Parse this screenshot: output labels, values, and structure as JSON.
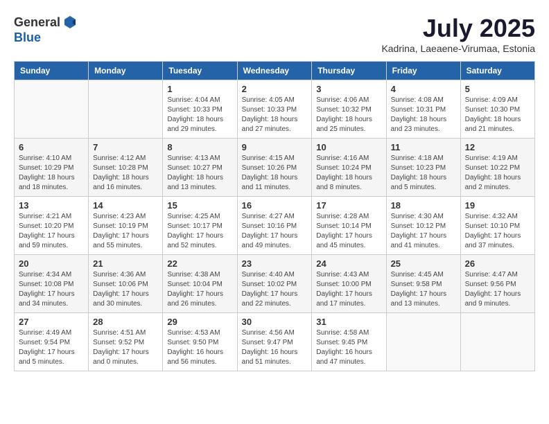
{
  "header": {
    "logo_general": "General",
    "logo_blue": "Blue",
    "month_title": "July 2025",
    "location": "Kadrina, Laeaene-Virumaa, Estonia"
  },
  "days_of_week": [
    "Sunday",
    "Monday",
    "Tuesday",
    "Wednesday",
    "Thursday",
    "Friday",
    "Saturday"
  ],
  "weeks": [
    [
      {
        "day": "",
        "info": ""
      },
      {
        "day": "",
        "info": ""
      },
      {
        "day": "1",
        "info": "Sunrise: 4:04 AM\nSunset: 10:33 PM\nDaylight: 18 hours\nand 29 minutes."
      },
      {
        "day": "2",
        "info": "Sunrise: 4:05 AM\nSunset: 10:33 PM\nDaylight: 18 hours\nand 27 minutes."
      },
      {
        "day": "3",
        "info": "Sunrise: 4:06 AM\nSunset: 10:32 PM\nDaylight: 18 hours\nand 25 minutes."
      },
      {
        "day": "4",
        "info": "Sunrise: 4:08 AM\nSunset: 10:31 PM\nDaylight: 18 hours\nand 23 minutes."
      },
      {
        "day": "5",
        "info": "Sunrise: 4:09 AM\nSunset: 10:30 PM\nDaylight: 18 hours\nand 21 minutes."
      }
    ],
    [
      {
        "day": "6",
        "info": "Sunrise: 4:10 AM\nSunset: 10:29 PM\nDaylight: 18 hours\nand 18 minutes."
      },
      {
        "day": "7",
        "info": "Sunrise: 4:12 AM\nSunset: 10:28 PM\nDaylight: 18 hours\nand 16 minutes."
      },
      {
        "day": "8",
        "info": "Sunrise: 4:13 AM\nSunset: 10:27 PM\nDaylight: 18 hours\nand 13 minutes."
      },
      {
        "day": "9",
        "info": "Sunrise: 4:15 AM\nSunset: 10:26 PM\nDaylight: 18 hours\nand 11 minutes."
      },
      {
        "day": "10",
        "info": "Sunrise: 4:16 AM\nSunset: 10:24 PM\nDaylight: 18 hours\nand 8 minutes."
      },
      {
        "day": "11",
        "info": "Sunrise: 4:18 AM\nSunset: 10:23 PM\nDaylight: 18 hours\nand 5 minutes."
      },
      {
        "day": "12",
        "info": "Sunrise: 4:19 AM\nSunset: 10:22 PM\nDaylight: 18 hours\nand 2 minutes."
      }
    ],
    [
      {
        "day": "13",
        "info": "Sunrise: 4:21 AM\nSunset: 10:20 PM\nDaylight: 17 hours\nand 59 minutes."
      },
      {
        "day": "14",
        "info": "Sunrise: 4:23 AM\nSunset: 10:19 PM\nDaylight: 17 hours\nand 55 minutes."
      },
      {
        "day": "15",
        "info": "Sunrise: 4:25 AM\nSunset: 10:17 PM\nDaylight: 17 hours\nand 52 minutes."
      },
      {
        "day": "16",
        "info": "Sunrise: 4:27 AM\nSunset: 10:16 PM\nDaylight: 17 hours\nand 49 minutes."
      },
      {
        "day": "17",
        "info": "Sunrise: 4:28 AM\nSunset: 10:14 PM\nDaylight: 17 hours\nand 45 minutes."
      },
      {
        "day": "18",
        "info": "Sunrise: 4:30 AM\nSunset: 10:12 PM\nDaylight: 17 hours\nand 41 minutes."
      },
      {
        "day": "19",
        "info": "Sunrise: 4:32 AM\nSunset: 10:10 PM\nDaylight: 17 hours\nand 37 minutes."
      }
    ],
    [
      {
        "day": "20",
        "info": "Sunrise: 4:34 AM\nSunset: 10:08 PM\nDaylight: 17 hours\nand 34 minutes."
      },
      {
        "day": "21",
        "info": "Sunrise: 4:36 AM\nSunset: 10:06 PM\nDaylight: 17 hours\nand 30 minutes."
      },
      {
        "day": "22",
        "info": "Sunrise: 4:38 AM\nSunset: 10:04 PM\nDaylight: 17 hours\nand 26 minutes."
      },
      {
        "day": "23",
        "info": "Sunrise: 4:40 AM\nSunset: 10:02 PM\nDaylight: 17 hours\nand 22 minutes."
      },
      {
        "day": "24",
        "info": "Sunrise: 4:43 AM\nSunset: 10:00 PM\nDaylight: 17 hours\nand 17 minutes."
      },
      {
        "day": "25",
        "info": "Sunrise: 4:45 AM\nSunset: 9:58 PM\nDaylight: 17 hours\nand 13 minutes."
      },
      {
        "day": "26",
        "info": "Sunrise: 4:47 AM\nSunset: 9:56 PM\nDaylight: 17 hours\nand 9 minutes."
      }
    ],
    [
      {
        "day": "27",
        "info": "Sunrise: 4:49 AM\nSunset: 9:54 PM\nDaylight: 17 hours\nand 5 minutes."
      },
      {
        "day": "28",
        "info": "Sunrise: 4:51 AM\nSunset: 9:52 PM\nDaylight: 17 hours\nand 0 minutes."
      },
      {
        "day": "29",
        "info": "Sunrise: 4:53 AM\nSunset: 9:50 PM\nDaylight: 16 hours\nand 56 minutes."
      },
      {
        "day": "30",
        "info": "Sunrise: 4:56 AM\nSunset: 9:47 PM\nDaylight: 16 hours\nand 51 minutes."
      },
      {
        "day": "31",
        "info": "Sunrise: 4:58 AM\nSunset: 9:45 PM\nDaylight: 16 hours\nand 47 minutes."
      },
      {
        "day": "",
        "info": ""
      },
      {
        "day": "",
        "info": ""
      }
    ]
  ]
}
